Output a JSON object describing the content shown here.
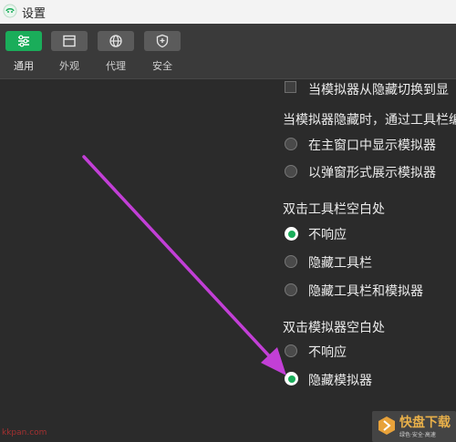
{
  "window": {
    "title": "设置"
  },
  "toolbar": {
    "items": [
      {
        "label": "通用",
        "icon": "sliders-icon"
      },
      {
        "label": "外观",
        "icon": "layout-icon"
      },
      {
        "label": "代理",
        "icon": "globe-icon"
      },
      {
        "label": "安全",
        "icon": "shield-icon"
      }
    ],
    "active": "通用",
    "accent": "#1aad5a"
  },
  "settings": {
    "switch_checkbox_label": "当模拟器从隐藏切换到显",
    "hidden_group_label": "当模拟器隐藏时，通过工具栏编",
    "hidden_options": [
      "在主窗口中显示模拟器",
      "以弹窗形式展示模拟器"
    ],
    "toolbar_dblclick_label": "双击工具栏空白处",
    "toolbar_dblclick_options": [
      "不响应",
      "隐藏工具栏",
      "隐藏工具栏和模拟器"
    ],
    "toolbar_dblclick_selected": "不响应",
    "simulator_dblclick_label": "双击模拟器空白处",
    "simulator_dblclick_options": [
      "不响应",
      "隐藏模拟器"
    ],
    "simulator_dblclick_selected": "隐藏模拟器"
  },
  "annotation": {
    "arrow_color": "#c23fd6"
  },
  "watermarks": {
    "left": "kkpan.com",
    "right_brand": "快盘下载",
    "right_sub": "绿色·安全·高速"
  }
}
